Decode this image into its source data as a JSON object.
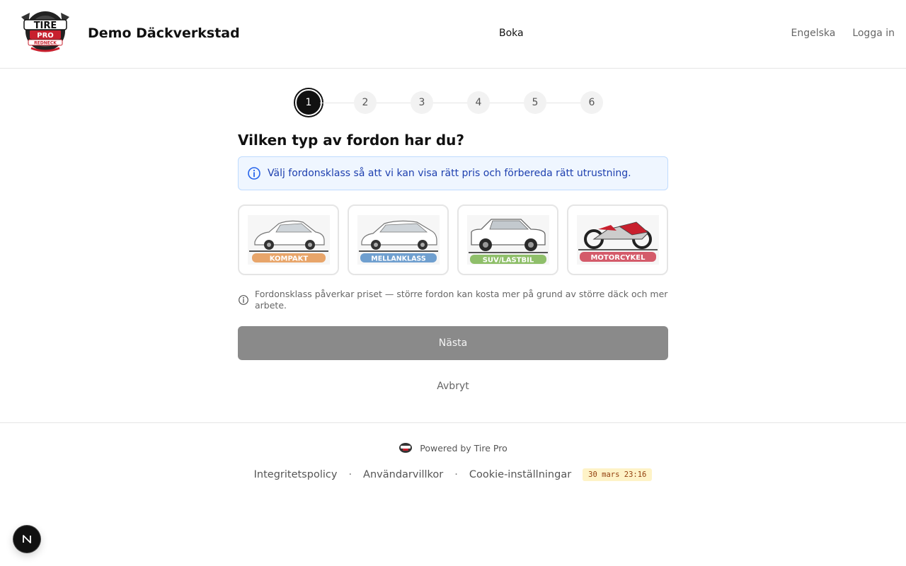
{
  "header": {
    "brand": "Demo Däckverkstad",
    "nav": {
      "book": "Boka",
      "language": "Engelska",
      "login": "Logga in"
    },
    "logo_text": {
      "line1": "TIRE",
      "line2": "PRO",
      "line3": "REDNECK"
    }
  },
  "stepper": {
    "steps": [
      "1",
      "2",
      "3",
      "4",
      "5",
      "6"
    ],
    "current": 1
  },
  "main": {
    "question": "Vilken typ av fordon har du?",
    "info": "Välj fordonsklass så att vi kan visa rätt pris och förbereda rätt utrustning.",
    "vehicles": [
      {
        "label": "KOMPAKT",
        "color": "#e8a56a"
      },
      {
        "label": "MELLANKLASS",
        "color": "#6f9fcf"
      },
      {
        "label": "SUV/LASTBIL",
        "color": "#8fbf6a"
      },
      {
        "label": "MOTORCYKEL",
        "color": "#d45b6a"
      }
    ],
    "note": "Fordonsklass påverkar priset — större fordon kan kosta mer på grund av större däck och mer arbete.",
    "next_label": "Nästa",
    "cancel_label": "Avbryt"
  },
  "footer": {
    "powered": "Powered by Tire Pro",
    "links": [
      "Integritetspolicy",
      "Användarvillkor",
      "Cookie-inställningar"
    ],
    "separator": "·",
    "timestamp": "30 mars 23:16"
  },
  "colors": {
    "primary": "#111111",
    "info_bg": "#eff6ff",
    "info_text": "#1e40af",
    "disabled_btn": "#8a8a8a"
  }
}
